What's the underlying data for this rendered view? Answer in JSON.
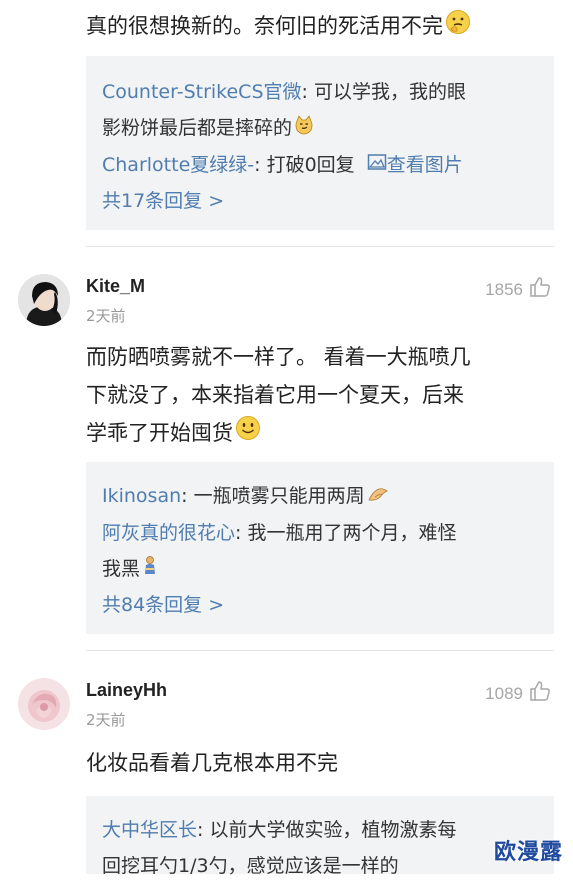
{
  "top_comment": {
    "text": "真的很想换新的。奈何旧的死活用不完",
    "emoji_icon": "thinking-face-icon"
  },
  "reply_box_1": {
    "replies": [
      {
        "user": "Counter-StrikeCS官微",
        "sep": ": ",
        "line1": "可以学我，我的眼",
        "line2": "影粉饼最后都是摔碎的",
        "emoji_icon": "smirk-cat-icon"
      },
      {
        "user": "Charlotte夏绿绿-",
        "sep": ": ",
        "text": "打破0回复",
        "image_link": "查看图片",
        "image_icon": "image-icon"
      }
    ],
    "more": "共17条回复 >"
  },
  "comments": [
    {
      "username": "Kite_M",
      "time": "2天前",
      "likes": "1856",
      "line1": "而防晒喷雾就不一样了。 看着一大瓶喷几",
      "line2": "下就没了，本来指着它用一个夏天，后来",
      "line3": "学乖了开始囤货",
      "emoji_icon": "smile-face-icon",
      "replies": [
        {
          "user": "Ikinosan",
          "sep": ": ",
          "text": "一瓶喷雾只能用两周",
          "emoji_icon": "folded-hands-icon"
        },
        {
          "user": "阿灰真的很花心",
          "sep": ": ",
          "line1": "我一瓶用了两个月，难怪",
          "line2": "我黑",
          "emoji_icon": "person-icon"
        }
      ],
      "more": "共84条回复 >"
    },
    {
      "username": "LaineyHh",
      "time": "2天前",
      "likes": "1089",
      "text": "化妆品看着几克根本用不完",
      "replies": [
        {
          "user": "大中华区长",
          "sep": ": ",
          "line1": "以前大学做实验，植物激素每",
          "line2": "回挖耳勺1/3勺，感觉应该是一样的"
        }
      ]
    }
  ],
  "watermark": "欧漫露",
  "colors": {
    "link_blue": "#507daf",
    "reply_bg": "#f2f3f5",
    "watermark": "#1f4a9e"
  }
}
